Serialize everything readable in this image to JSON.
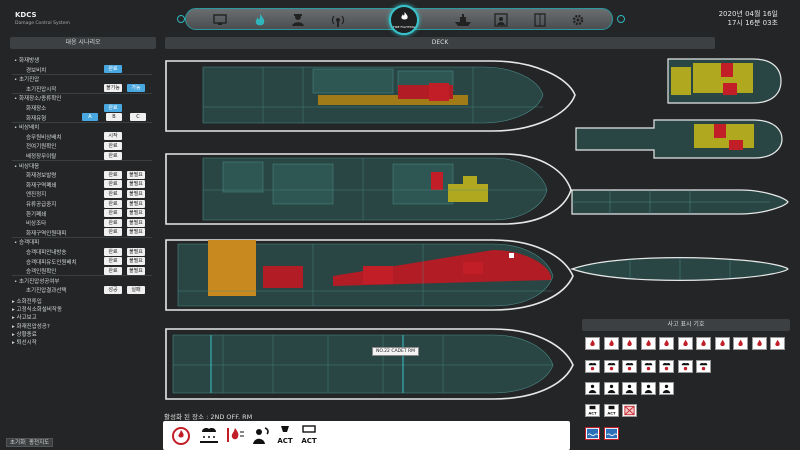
{
  "app": {
    "title": "KDCS",
    "subtitle": "Damage Control System",
    "date": "2020년 04월 16일",
    "time": "17시 16분 03초",
    "center_nav_label": "FIRE FIGHTING"
  },
  "left_panel": {
    "header": "대응 시나리오",
    "rows": [
      {
        "text": "화재방생",
        "indent": 0,
        "bullet": true
      },
      {
        "text": "경보비치",
        "indent": 2,
        "buttons": [
          {
            "label": "완료",
            "style": "lblue"
          }
        ]
      },
      {
        "text": "초기진압",
        "indent": 0,
        "bullet": true
      },
      {
        "text": "초기진압시작",
        "indent": 2,
        "buttons": [
          {
            "label": "불가능",
            "style": "white"
          },
          {
            "label": "가능",
            "style": "lblue"
          }
        ]
      },
      {
        "text": "화재장소/종류확인",
        "indent": 0,
        "bullet": true
      },
      {
        "text": "화재장소",
        "indent": 2,
        "buttons": [
          {
            "label": "완료",
            "style": "lblue"
          }
        ]
      },
      {
        "text": "화재유형",
        "indent": 2,
        "buttons": [
          {
            "label": "A",
            "style": "lblue"
          },
          {
            "label": "B",
            "style": "white"
          },
          {
            "label": "C",
            "style": "white"
          }
        ]
      },
      {
        "text": "비상배치",
        "indent": 0,
        "bullet": true
      },
      {
        "text": "승무원비상배치",
        "indent": 2,
        "buttons": [
          {
            "label": "시작",
            "style": "white"
          }
        ]
      },
      {
        "text": "전여기원확인",
        "indent": 2,
        "buttons": [
          {
            "label": "완료",
            "style": "white"
          }
        ]
      },
      {
        "text": "배정장무이탈",
        "indent": 2,
        "buttons": [
          {
            "label": "완료",
            "style": "white"
          }
        ]
      },
      {
        "text": "비상대응",
        "indent": 0,
        "bullet": true
      },
      {
        "text": "화재경보발령",
        "indent": 2,
        "buttons": [
          {
            "label": "완료",
            "style": "white"
          },
          {
            "label": "불필요",
            "style": "white"
          }
        ]
      },
      {
        "text": "화재구역폐쇄",
        "indent": 2,
        "buttons": [
          {
            "label": "완료",
            "style": "white"
          },
          {
            "label": "불필요",
            "style": "white"
          }
        ]
      },
      {
        "text": "엔진정지",
        "indent": 2,
        "buttons": [
          {
            "label": "완료",
            "style": "white"
          },
          {
            "label": "불필요",
            "style": "white"
          }
        ]
      },
      {
        "text": "유류공급중지",
        "indent": 2,
        "buttons": [
          {
            "label": "완료",
            "style": "white"
          },
          {
            "label": "불필요",
            "style": "white"
          }
        ]
      },
      {
        "text": "환기폐쇄",
        "indent": 2,
        "buttons": [
          {
            "label": "완료",
            "style": "white"
          },
          {
            "label": "불필요",
            "style": "white"
          }
        ]
      },
      {
        "text": "비상조타",
        "indent": 2,
        "buttons": [
          {
            "label": "완료",
            "style": "white"
          },
          {
            "label": "불필요",
            "style": "white"
          }
        ]
      },
      {
        "text": "화재구역인원대피",
        "indent": 2,
        "buttons": [
          {
            "label": "완료",
            "style": "white"
          },
          {
            "label": "불필요",
            "style": "white"
          }
        ]
      },
      {
        "text": "승객대피",
        "indent": 0,
        "bullet": true
      },
      {
        "text": "승객대피안내방송",
        "indent": 2,
        "buttons": [
          {
            "label": "완료",
            "style": "white"
          },
          {
            "label": "불필요",
            "style": "white"
          }
        ]
      },
      {
        "text": "승객대피유도인원배치",
        "indent": 2,
        "buttons": [
          {
            "label": "완료",
            "style": "white"
          },
          {
            "label": "불필요",
            "style": "white"
          }
        ]
      },
      {
        "text": "승객인원확인",
        "indent": 2,
        "buttons": [
          {
            "label": "완료",
            "style": "white"
          },
          {
            "label": "불필요",
            "style": "white"
          }
        ]
      },
      {
        "text": "초기진압성공여부",
        "indent": 0,
        "bullet": true
      },
      {
        "text": "초기진압결과선택",
        "indent": 2,
        "buttons": [
          {
            "label": "성공",
            "style": "white"
          },
          {
            "label": "실패",
            "style": "white"
          }
        ]
      }
    ],
    "collapsed": [
      "소화전투입",
      "고정식소화설비작동",
      "사고보고",
      "화재진압성공?",
      "상황종료",
      "퇴선시작"
    ],
    "bottom_buttons": [
      "초기화",
      "종전지도"
    ]
  },
  "deck": {
    "header": "DECK",
    "tooltip": "NO.22 CADET RM",
    "location_label": "활성화 된 장소 : 2ND OFF. RM",
    "status_icons": [
      "fire-alarm-icon",
      "cloud-spray-icon",
      "fire-heat-icon",
      "person-smoke-icon",
      "act-icon",
      "act-drone-icon"
    ],
    "act_label": "ACT"
  },
  "legend": {
    "header": "사고 표시 기호",
    "act_label": "ACT"
  },
  "colors": {
    "accent": "#2fb6bd",
    "fire_red": "#c8202a",
    "orange": "#c8891e",
    "olive": "#b0a81e",
    "hull": "#2d6f6d"
  }
}
